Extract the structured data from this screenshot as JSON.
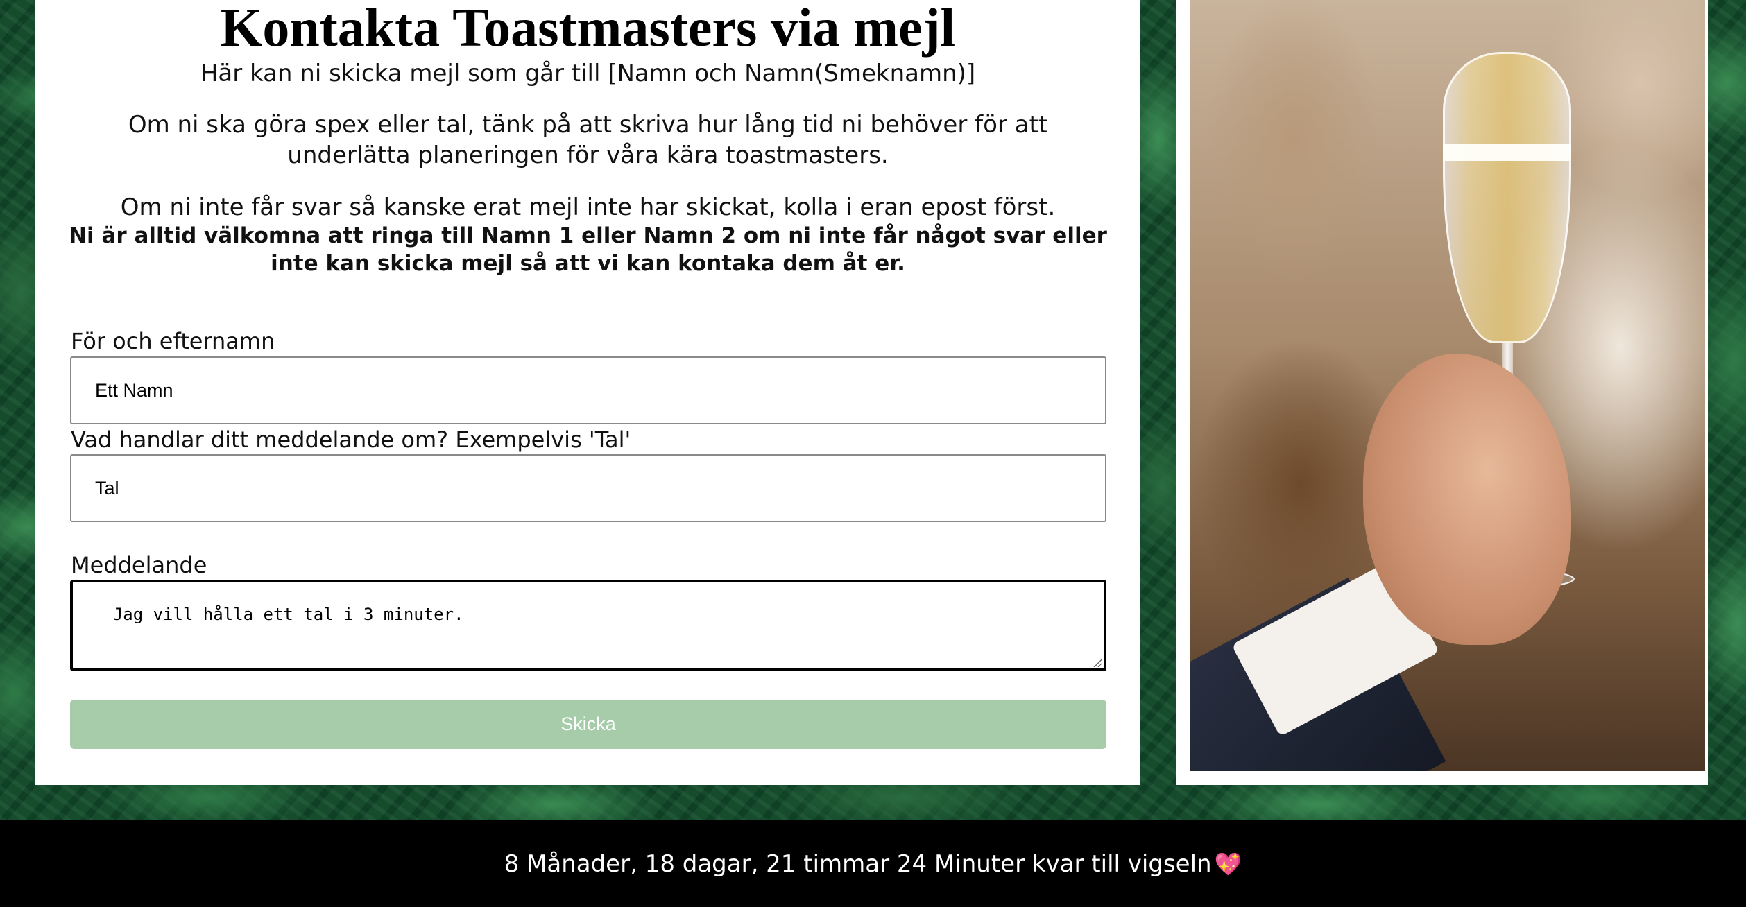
{
  "contact": {
    "title": "Kontakta Toastmasters via mejl",
    "subtitle": "Här kan ni skicka mejl som går till [Namn och Namn(Smeknamn)]",
    "para1": "Om ni ska göra spex eller tal, tänk på att skriva hur lång tid ni behöver för att underlätta planeringen för våra kära toastmasters.",
    "para2": "Om ni inte får svar så kanske erat mejl inte har skickat, kolla i eran epost först.",
    "para3": "Ni är alltid välkomna att ringa till Namn 1 eller Namn 2 om ni inte får något svar eller inte kan skicka mejl så att vi kan kontaka dem åt er."
  },
  "form": {
    "name_label": "För och efternamn",
    "name_value": "Ett Namn",
    "subject_label": "Vad handlar ditt meddelande om? Exempelvis 'Tal'",
    "subject_value": "Tal",
    "message_label": "Meddelande",
    "message_value": "Jag vill hålla ett tal i 3 minuter.",
    "submit_label": "Skicka",
    "submit_color": "#a7cca9"
  },
  "photo": {
    "icon": "champagne-toast-photo"
  },
  "footer": {
    "countdown": "8 Månader, 18 dagar, 21 timmar 24 Minuter kvar till vigseln",
    "emoji": "💖"
  }
}
